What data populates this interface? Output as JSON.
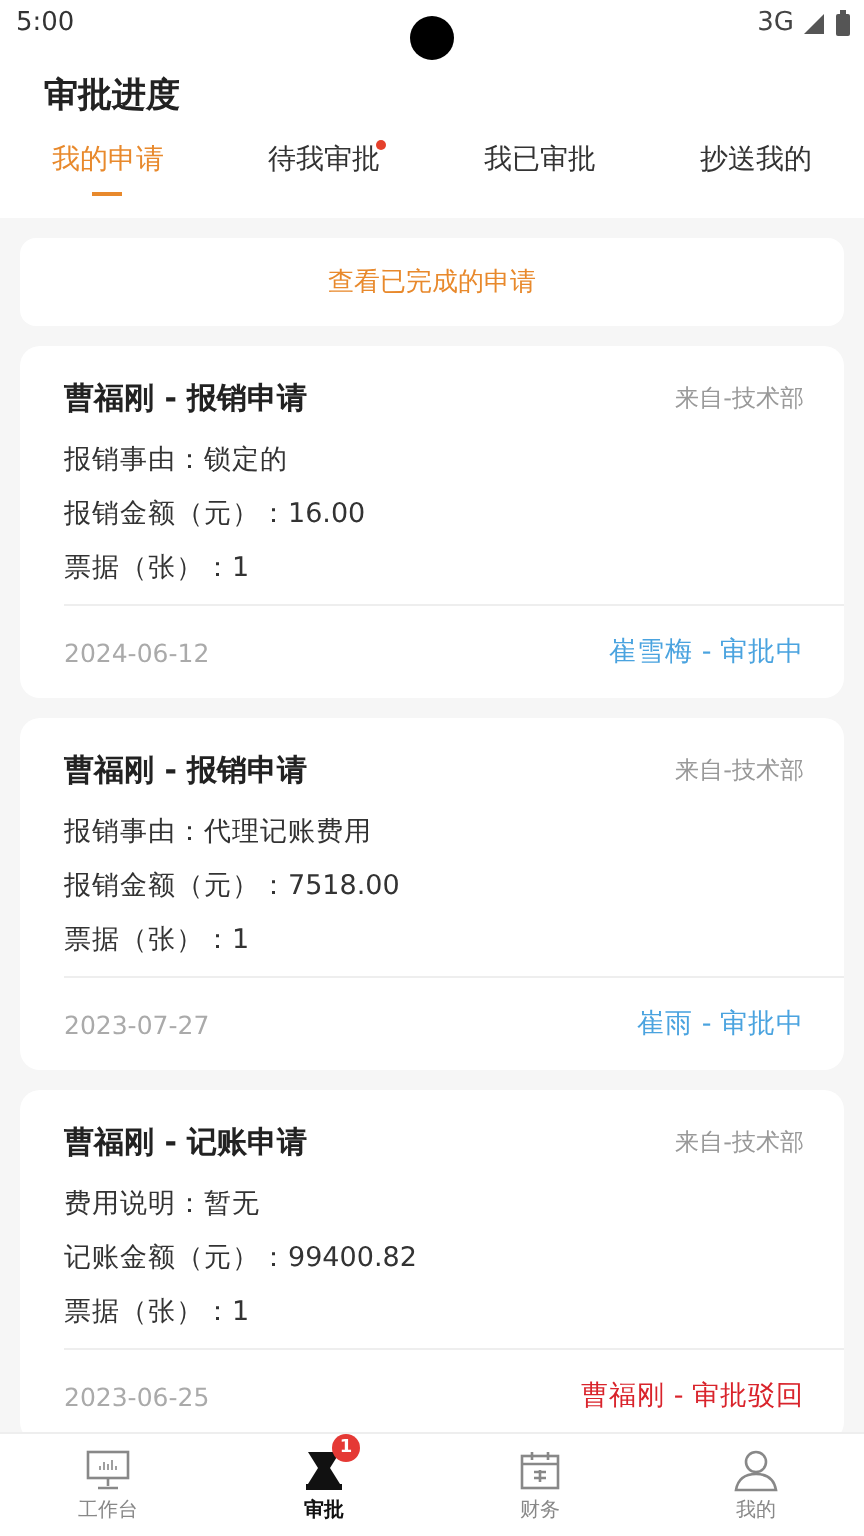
{
  "status_bar": {
    "time": "5:00",
    "network": "3G"
  },
  "title": "审批进度",
  "tabs": [
    {
      "label": "我的申请",
      "selected": true,
      "dot": false
    },
    {
      "label": "待我审批",
      "selected": false,
      "dot": true
    },
    {
      "label": "我已审批",
      "selected": false,
      "dot": false
    },
    {
      "label": "抄送我的",
      "selected": false,
      "dot": false
    }
  ],
  "completed_link": "查看已完成的申请",
  "applications": [
    {
      "title": "曹福刚 - 报销申请",
      "department": "来自-技术部",
      "details": [
        "报销事由：锁定的",
        "报销金额（元）：16.00",
        "票据（张）：1"
      ],
      "date": "2024-06-12",
      "status": {
        "text": "崔雪梅 - 审批中",
        "color": "#4aa3df"
      }
    },
    {
      "title": "曹福刚 - 报销申请",
      "department": "来自-技术部",
      "details": [
        "报销事由：代理记账费用",
        "报销金额（元）：7518.00",
        "票据（张）：1"
      ],
      "date": "2023-07-27",
      "status": {
        "text": "崔雨 - 审批中",
        "color": "#4aa3df"
      }
    },
    {
      "title": "曹福刚 - 记账申请",
      "department": "来自-技术部",
      "details": [
        "费用说明：暂无",
        "记账金额（元）：99400.82",
        "票据（张）：1"
      ],
      "date": "2023-06-25",
      "status": {
        "text": "曹福刚 - 审批驳回",
        "color": "#d9232b"
      }
    }
  ],
  "bottom_nav": [
    {
      "label": "工作台",
      "selected": false
    },
    {
      "label": "审批",
      "selected": true,
      "badge": "1"
    },
    {
      "label": "财务",
      "selected": false
    },
    {
      "label": "我的",
      "selected": false
    }
  ]
}
